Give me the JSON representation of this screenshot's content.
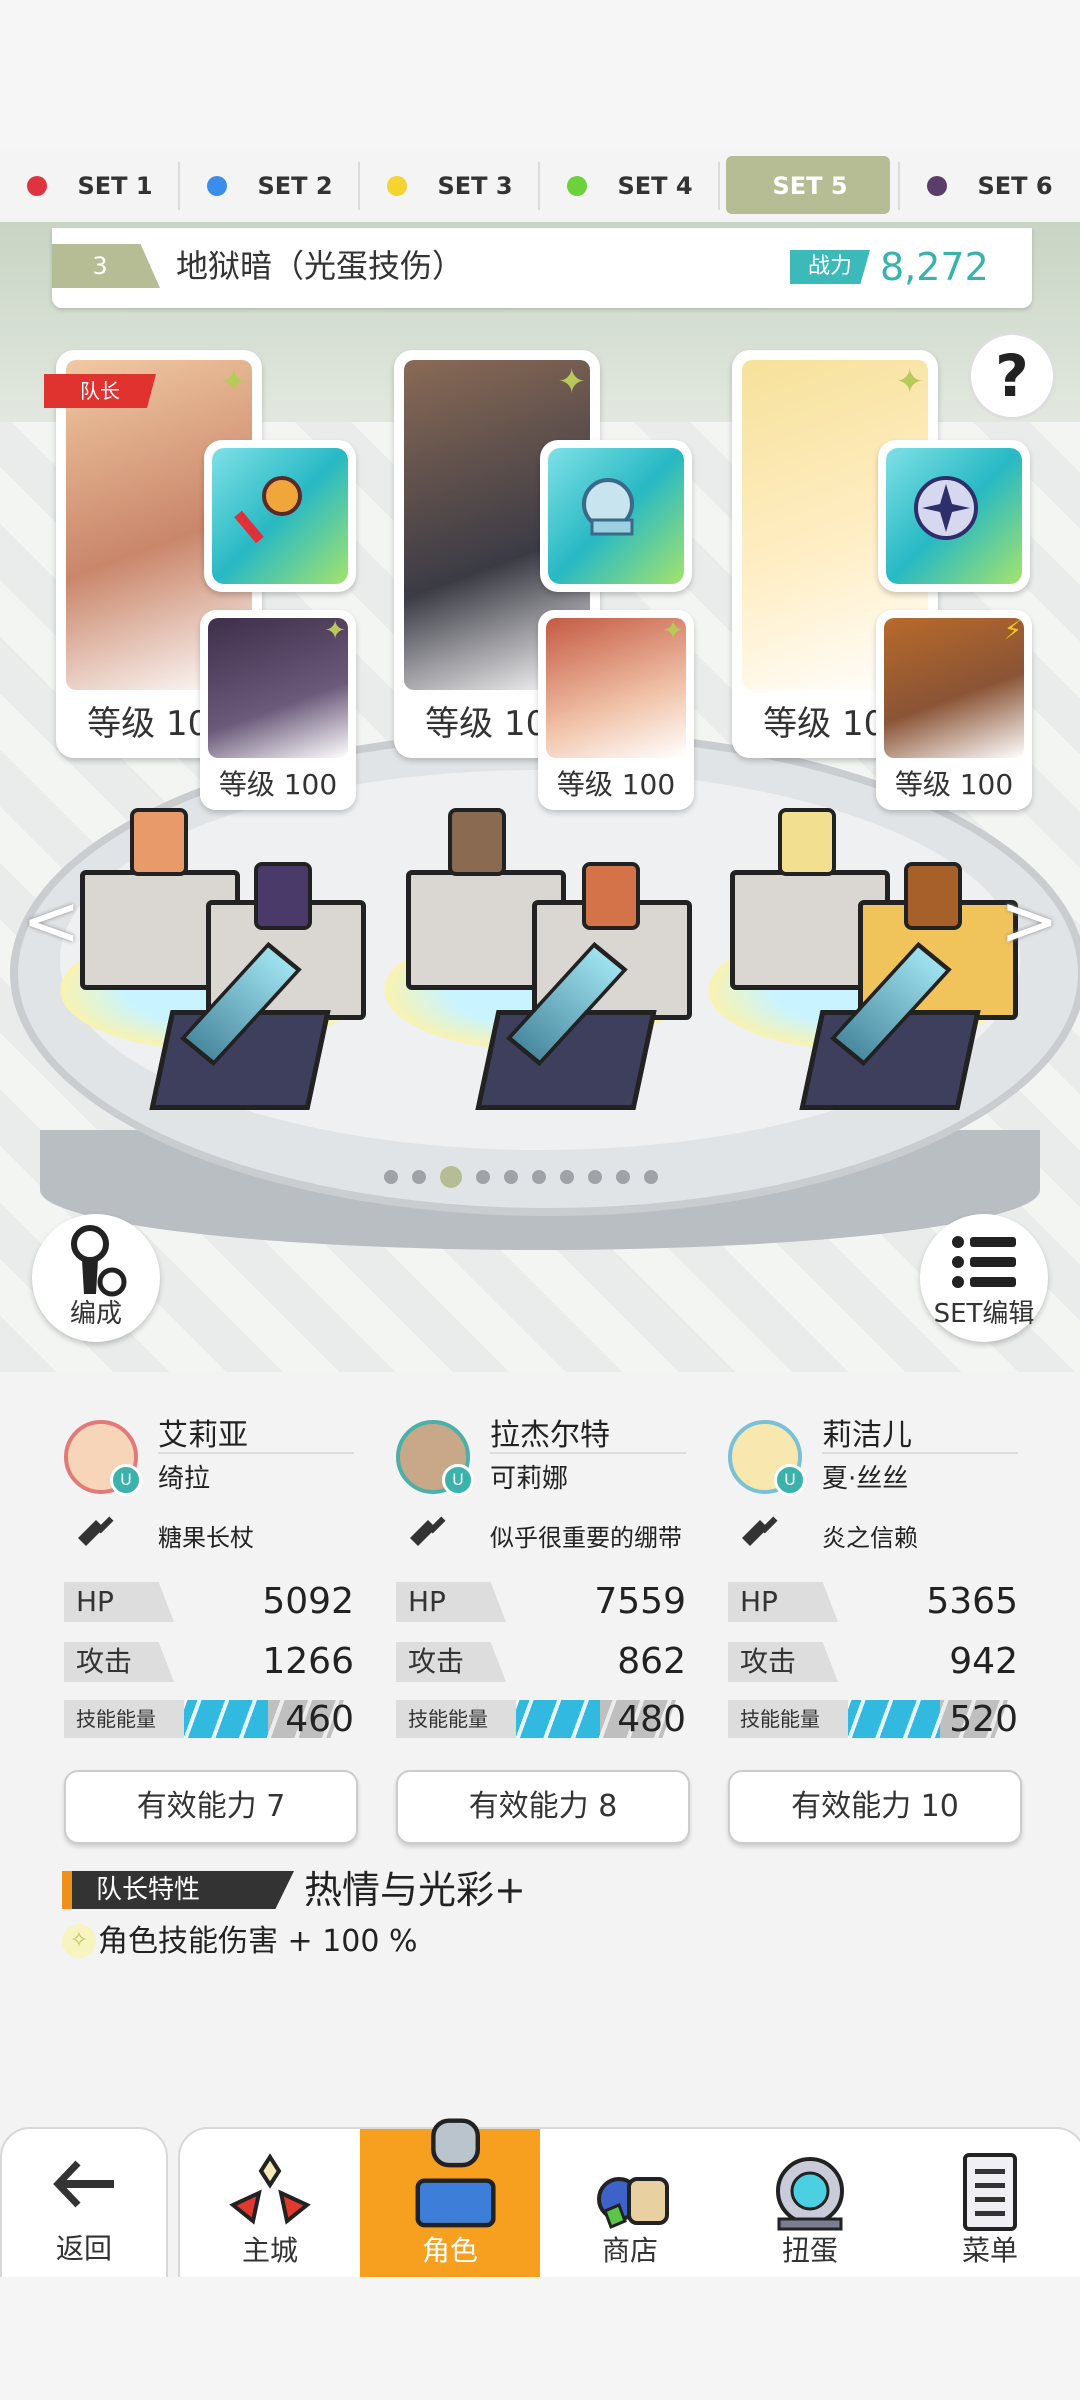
{
  "set_tabs": [
    {
      "label": "SET 1",
      "color": "#e0333f"
    },
    {
      "label": "SET 2",
      "color": "#3a8de8"
    },
    {
      "label": "SET 3",
      "color": "#f3d431"
    },
    {
      "label": "SET 4",
      "color": "#6cd13a"
    },
    {
      "label": "SET 5",
      "color": "#b6bd94"
    },
    {
      "label": "SET 6",
      "color": "#5a3d6a"
    }
  ],
  "active_set": "SET 5",
  "team": {
    "number": "3",
    "name": "地狱暗（光蛋技伤）",
    "power_label": "战力",
    "power_value": "8,272"
  },
  "help_label": "?",
  "captain_label": "队长",
  "cards": [
    {
      "level": "等级 100",
      "sub_level": "等级 100"
    },
    {
      "level": "等级 100",
      "sub_level": "等级 100"
    },
    {
      "level": "等级 100",
      "sub_level": "等级 100"
    }
  ],
  "pager": {
    "count": 10,
    "active": 2
  },
  "arrows": {
    "left": "<",
    "right": ">"
  },
  "buttons": {
    "formation": "编成",
    "set_edit": "SET编辑"
  },
  "characters": [
    {
      "name": "艾莉亚",
      "support": "绮拉",
      "weapon": "糖果长杖",
      "hp_label": "HP",
      "hp": "5092",
      "atk_label": "攻击",
      "atk": "1266",
      "energy_label": "技能能量",
      "energy": "460",
      "effective": "有效能力 7"
    },
    {
      "name": "拉杰尔特",
      "support": "可莉娜",
      "weapon": "似乎很重要的绷带",
      "hp_label": "HP",
      "hp": "7559",
      "atk_label": "攻击",
      "atk": "862",
      "energy_label": "技能能量",
      "energy": "480",
      "effective": "有效能力 8"
    },
    {
      "name": "莉洁儿",
      "support": "夏·丝丝",
      "weapon": "炎之信赖",
      "hp_label": "HP",
      "hp": "5365",
      "atk_label": "攻击",
      "atk": "942",
      "energy_label": "技能能量",
      "energy": "520",
      "effective": "有效能力 10"
    }
  ],
  "energy_fill": [
    0.55,
    0.55,
    0.6
  ],
  "leader": {
    "tag": "队长特性",
    "name": "热情与光彩+",
    "effect": "角色技能伤害 + 100 %"
  },
  "nav": {
    "back": "返回",
    "items": [
      "主城",
      "角色",
      "商店",
      "扭蛋",
      "菜单"
    ],
    "active": "角色"
  }
}
